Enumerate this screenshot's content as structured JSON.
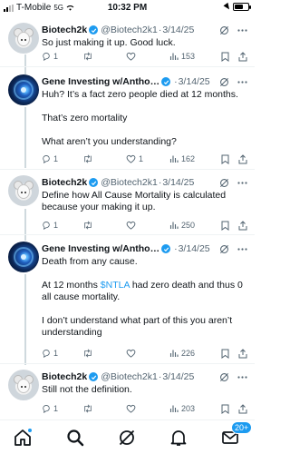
{
  "status_bar": {
    "carrier": "T-Mobile",
    "network": "5G",
    "time": "10:32 PM"
  },
  "tweets": [
    {
      "name": "Biotech2k",
      "handle": "@Biotech2k1",
      "date": "3/14/25",
      "text": "So just making it up. Good luck.",
      "replies": "1",
      "retweets": "",
      "likes": "",
      "views": "153",
      "avatar": "mouse-avatar"
    },
    {
      "name": "Gene Investing w/Antho…",
      "handle": "",
      "date": "3/14/25",
      "text": "Huh? It’s a fact zero people died at 12 months.\n\nThat’s zero mortality\n\nWhat aren’t you understanding?",
      "replies": "1",
      "retweets": "",
      "likes": "1",
      "views": "162",
      "avatar": "gene-avatar"
    },
    {
      "name": "Biotech2k",
      "handle": "@Biotech2k1",
      "date": "3/14/25",
      "text": "Define how All Cause Mortality is calculated because your making it up.",
      "replies": "1",
      "retweets": "",
      "likes": "",
      "views": "250",
      "avatar": "mouse-avatar"
    },
    {
      "name": "Gene Investing w/Antho…",
      "handle": "",
      "date": "3/14/25",
      "text_before_cashtag": "Death from any cause.\n\nAt 12 months ",
      "cashtag": "$NTLA",
      "text_after_cashtag": " had zero death and thus 0 all cause mortality.\n\nI don’t understand what part of this you aren’t understanding",
      "replies": "1",
      "retweets": "",
      "likes": "",
      "views": "226",
      "avatar": "gene-avatar"
    },
    {
      "name": "Biotech2k",
      "handle": "@Biotech2k1",
      "date": "3/14/25",
      "text": "Still not the definition.",
      "replies": "1",
      "retweets": "",
      "likes": "",
      "views": "203",
      "avatar": "mouse-avatar"
    }
  ],
  "bottom_nav": {
    "items": [
      "home-icon",
      "search-icon",
      "grok-icon",
      "notifications-icon",
      "messages-icon"
    ],
    "messages_badge": "20+"
  },
  "colors": {
    "accent": "#1d9bf0",
    "text": "#0f1419",
    "secondary": "#536471",
    "divider": "#eff3f4"
  }
}
